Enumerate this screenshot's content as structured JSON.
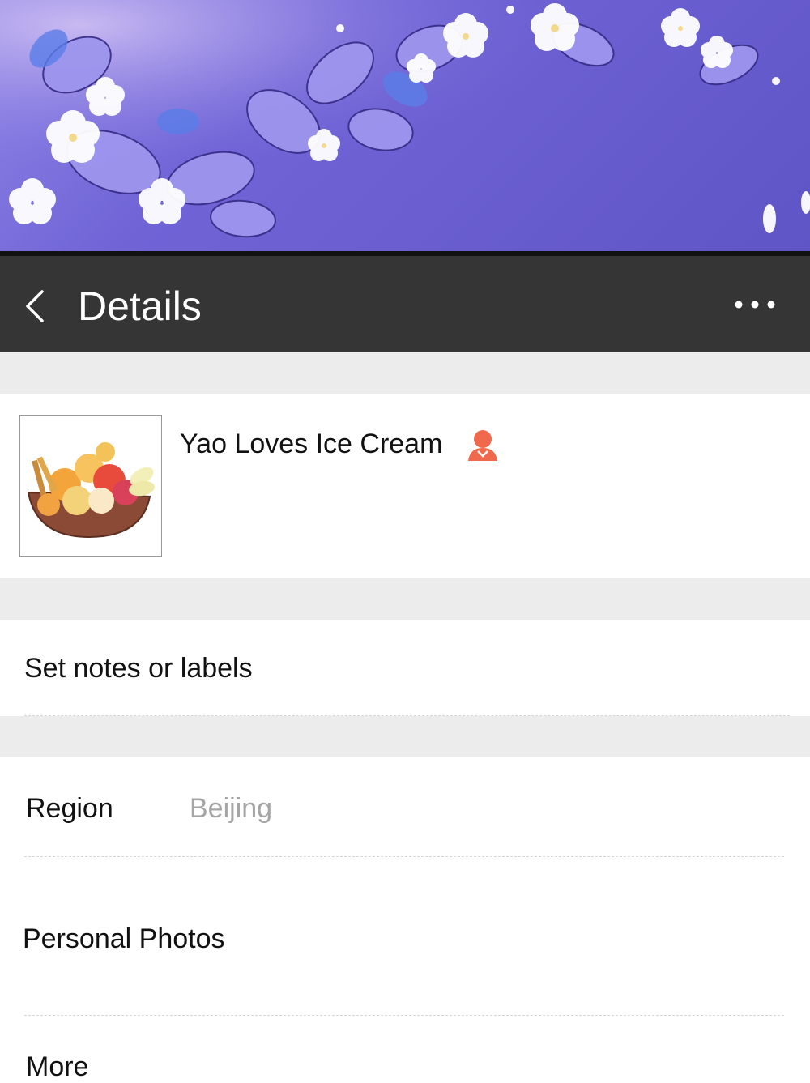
{
  "header": {
    "title": "Details",
    "back_icon": "chevron-left-icon",
    "more_icon": "more-dots-icon"
  },
  "profile": {
    "name": "Yao Loves Ice Cream",
    "avatar": "ice-cream-bowl-avatar",
    "gender_icon": "person-icon",
    "gender_icon_color": "#f0694c"
  },
  "rows": {
    "notes_label": "Set notes or labels",
    "region_label": "Region",
    "region_value": "Beijing",
    "photos_label": "Personal Photos",
    "more_label": "More"
  },
  "colors": {
    "header_bg": "#353535",
    "section_gap": "#ececec",
    "banner": "#6f63d6"
  }
}
